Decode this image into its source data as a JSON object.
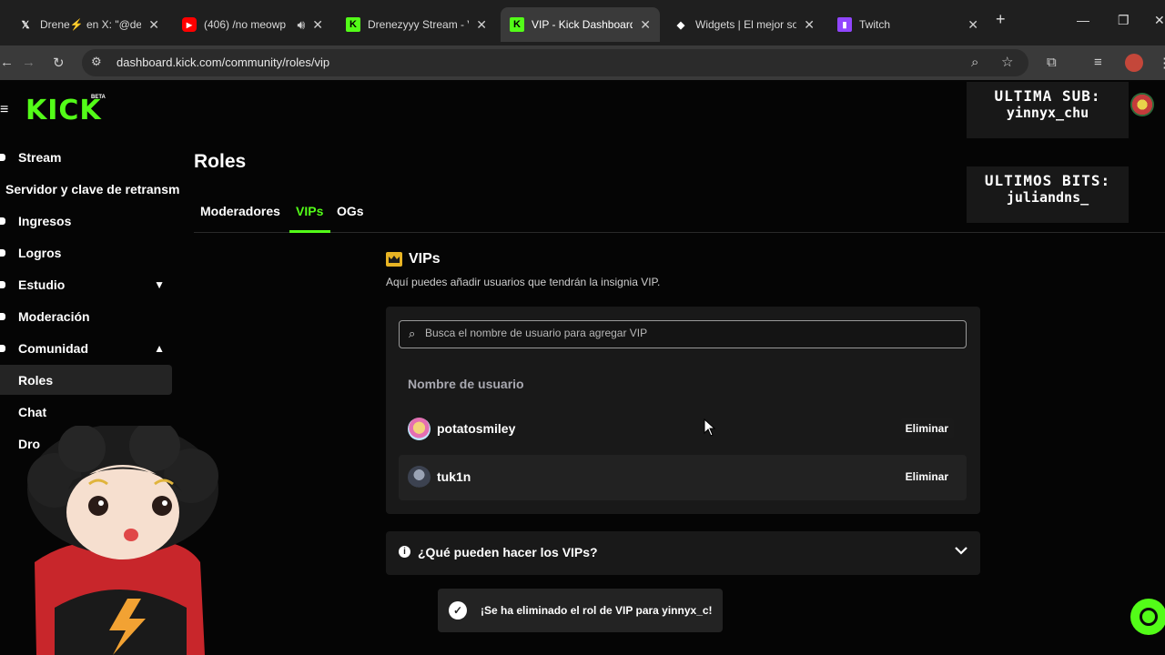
{
  "browser": {
    "tabs": [
      {
        "title": "Drene⚡ en X: \"@de",
        "icon": "x-logo-icon"
      },
      {
        "title": "(406) /no meowp",
        "icon": "youtube-icon"
      },
      {
        "title": "Drenezyyy Stream - V",
        "icon": "kick-icon"
      },
      {
        "title": "VIP - Kick Dashboard",
        "icon": "kick-icon"
      },
      {
        "title": "Widgets | El mejor so",
        "icon": "widget-icon"
      },
      {
        "title": "Twitch",
        "icon": "twitch-icon"
      }
    ],
    "active_tab_index": 3,
    "url": "dashboard.kick.com/community/roles/vip"
  },
  "app": {
    "logo": "KICK",
    "logo_badge": "BETA"
  },
  "sidebar": {
    "items": [
      {
        "label": "Stream"
      },
      {
        "label": "Servidor y clave de retransm"
      },
      {
        "label": "Ingresos"
      },
      {
        "label": "Logros"
      },
      {
        "label": "Estudio"
      },
      {
        "label": "Moderación"
      },
      {
        "label": "Comunidad"
      },
      {
        "label": "Roles"
      },
      {
        "label": "Chat"
      },
      {
        "label": "Dro"
      }
    ]
  },
  "main": {
    "title": "Roles",
    "tabs": [
      {
        "label": "Moderadores"
      },
      {
        "label": "VIPs"
      },
      {
        "label": "OGs"
      }
    ],
    "vip_section": {
      "title": "VIPs",
      "description": "Aquí puedes añadir usuarios que tendrán la insignia VIP.",
      "search_placeholder": "Busca el nombre de usuario para agregar VIP",
      "column_header": "Nombre de usuario",
      "users": [
        {
          "name": "potatosmiley",
          "action": "Eliminar"
        },
        {
          "name": "tuk1n",
          "action": "Eliminar"
        }
      ]
    },
    "faq": {
      "question": "¿Qué pueden hacer los VIPs?"
    },
    "toast": {
      "message": "¡Se ha eliminado el rol de VIP para yinnyx_c!"
    }
  },
  "overlay": {
    "sub_label": "ULTIMA SUB:",
    "sub_value": "yinnyx_chu",
    "bits_label": "ULTIMOS BITS:",
    "bits_value": "juliandns_"
  },
  "colors": {
    "accent": "#53fc18",
    "background": "#050505",
    "card": "#191919",
    "crown": "#e8b424"
  }
}
